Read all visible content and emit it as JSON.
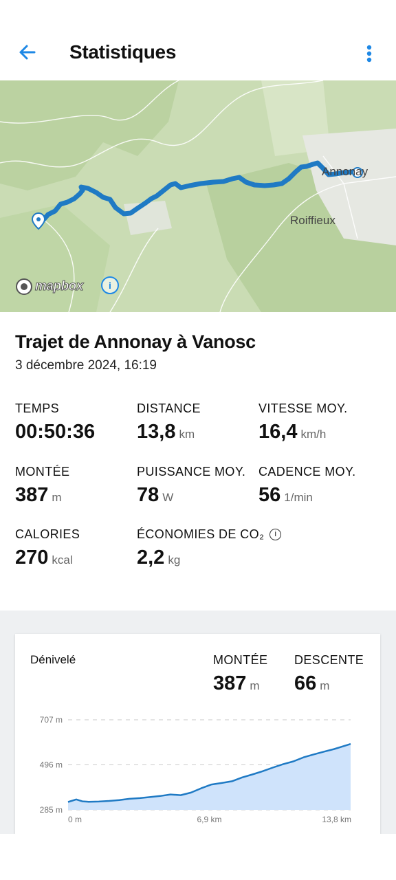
{
  "header": {
    "title": "Statistiques",
    "back_icon": "arrow-back-icon",
    "menu_icon": "more-vert-icon",
    "accent": "#1e88e5"
  },
  "map": {
    "labels": [
      "Annonay",
      "Roiffieux"
    ],
    "attribution": "mapbox",
    "route_color": "#1f7ac4"
  },
  "trip": {
    "title": "Trajet de Annonay à Vanosc",
    "date": "3 décembre 2024, 16:19"
  },
  "stats": [
    {
      "label": "TEMPS",
      "value": "00:50:36",
      "unit": ""
    },
    {
      "label": "DISTANCE",
      "value": "13,8",
      "unit": "km"
    },
    {
      "label": "VITESSE MOY.",
      "value": "16,4",
      "unit": "km/h"
    },
    {
      "label": "MONTÉE",
      "value": "387",
      "unit": "m"
    },
    {
      "label": "PUISSANCE MOY.",
      "value": "78",
      "unit": "W"
    },
    {
      "label": "CADENCE MOY.",
      "value": "56",
      "unit": "1/min"
    },
    {
      "label": "CALORIES",
      "value": "270",
      "unit": "kcal"
    },
    {
      "label": "ÉCONOMIES DE CO₂",
      "value": "2,2",
      "unit": "kg"
    }
  ],
  "elevation_card": {
    "title": "Dénivelé",
    "climb_label": "MONTÉE",
    "climb_value": "387",
    "climb_unit": "m",
    "descent_label": "DESCENTE",
    "descent_value": "66",
    "descent_unit": "m"
  },
  "chart_data": {
    "type": "area",
    "xlabel": "",
    "ylabel": "",
    "x_ticks": [
      "0 m",
      "6,9 km",
      "13,8 km"
    ],
    "y_ticks": [
      "707 m",
      "496 m",
      "285 m"
    ],
    "xlim": [
      0,
      13.8
    ],
    "ylim": [
      285,
      707
    ],
    "grid": true,
    "fill_color": "#cfe3fb",
    "line_color": "#1f7ac4",
    "x": [
      0,
      0.4,
      0.7,
      1.0,
      1.5,
      2.0,
      2.5,
      3.0,
      3.5,
      4.0,
      4.5,
      5.0,
      5.5,
      6.0,
      6.5,
      7.0,
      7.5,
      8.0,
      8.5,
      9.0,
      9.5,
      10.0,
      10.5,
      11.0,
      11.5,
      12.0,
      12.5,
      13.0,
      13.4,
      13.8
    ],
    "y": [
      322,
      334,
      325,
      323,
      324,
      327,
      331,
      337,
      340,
      345,
      350,
      357,
      354,
      366,
      386,
      404,
      411,
      419,
      437,
      451,
      466,
      483,
      499,
      512,
      531,
      545,
      558,
      570,
      582,
      594
    ]
  }
}
